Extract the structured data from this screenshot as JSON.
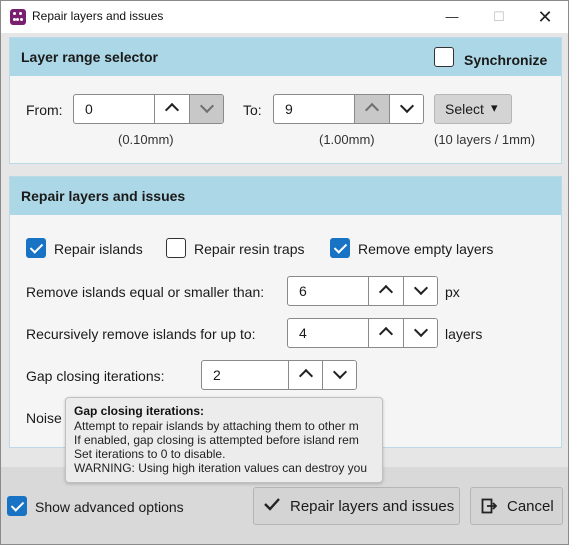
{
  "window": {
    "title": "Repair layers and issues",
    "minimize_glyph": "—",
    "maximize_glyph": "☐",
    "close_glyph": "✕"
  },
  "layer_range": {
    "heading": "Layer range selector",
    "synchronize_label": "Synchronize",
    "synchronize_checked": false,
    "from_label": "From:",
    "from_value": "0",
    "from_hint": "(0.10mm)",
    "to_label": "To:",
    "to_value": "9",
    "to_hint": "(1.00mm)",
    "select_label": "Select",
    "select_arrow": "▾",
    "range_summary": "(10 layers / 1mm)"
  },
  "repair": {
    "heading": "Repair layers and issues",
    "repair_islands_label": "Repair islands",
    "repair_islands_checked": true,
    "repair_resin_traps_label": "Repair resin traps",
    "repair_resin_traps_checked": false,
    "remove_empty_layers_label": "Remove empty layers",
    "remove_empty_layers_checked": true,
    "remove_islands_label": "Remove islands equal or smaller than:",
    "remove_islands_value": "6",
    "remove_islands_unit": "px",
    "recursive_label": "Recursively remove islands for up to:",
    "recursive_value": "4",
    "recursive_unit": "layers",
    "gap_closing_label": "Gap closing iterations:",
    "gap_closing_value": "2",
    "noise_label": "Noise"
  },
  "tooltip": {
    "title": "Gap closing iterations:",
    "lines": [
      "Attempt to repair islands by attaching them to other m",
      "If enabled, gap closing is attempted before island rem",
      "Set iterations to 0 to disable.",
      "WARNING: Using high iteration values can destroy you"
    ]
  },
  "footer": {
    "show_advanced_label": "Show advanced options",
    "show_advanced_checked": true,
    "repair_button_label": "Repair layers and issues",
    "cancel_button_label": "Cancel"
  },
  "colors": {
    "panel_header": "#acd7e6",
    "checkbox_accent": "#1873c4",
    "app_icon": "#7a1f6f"
  }
}
